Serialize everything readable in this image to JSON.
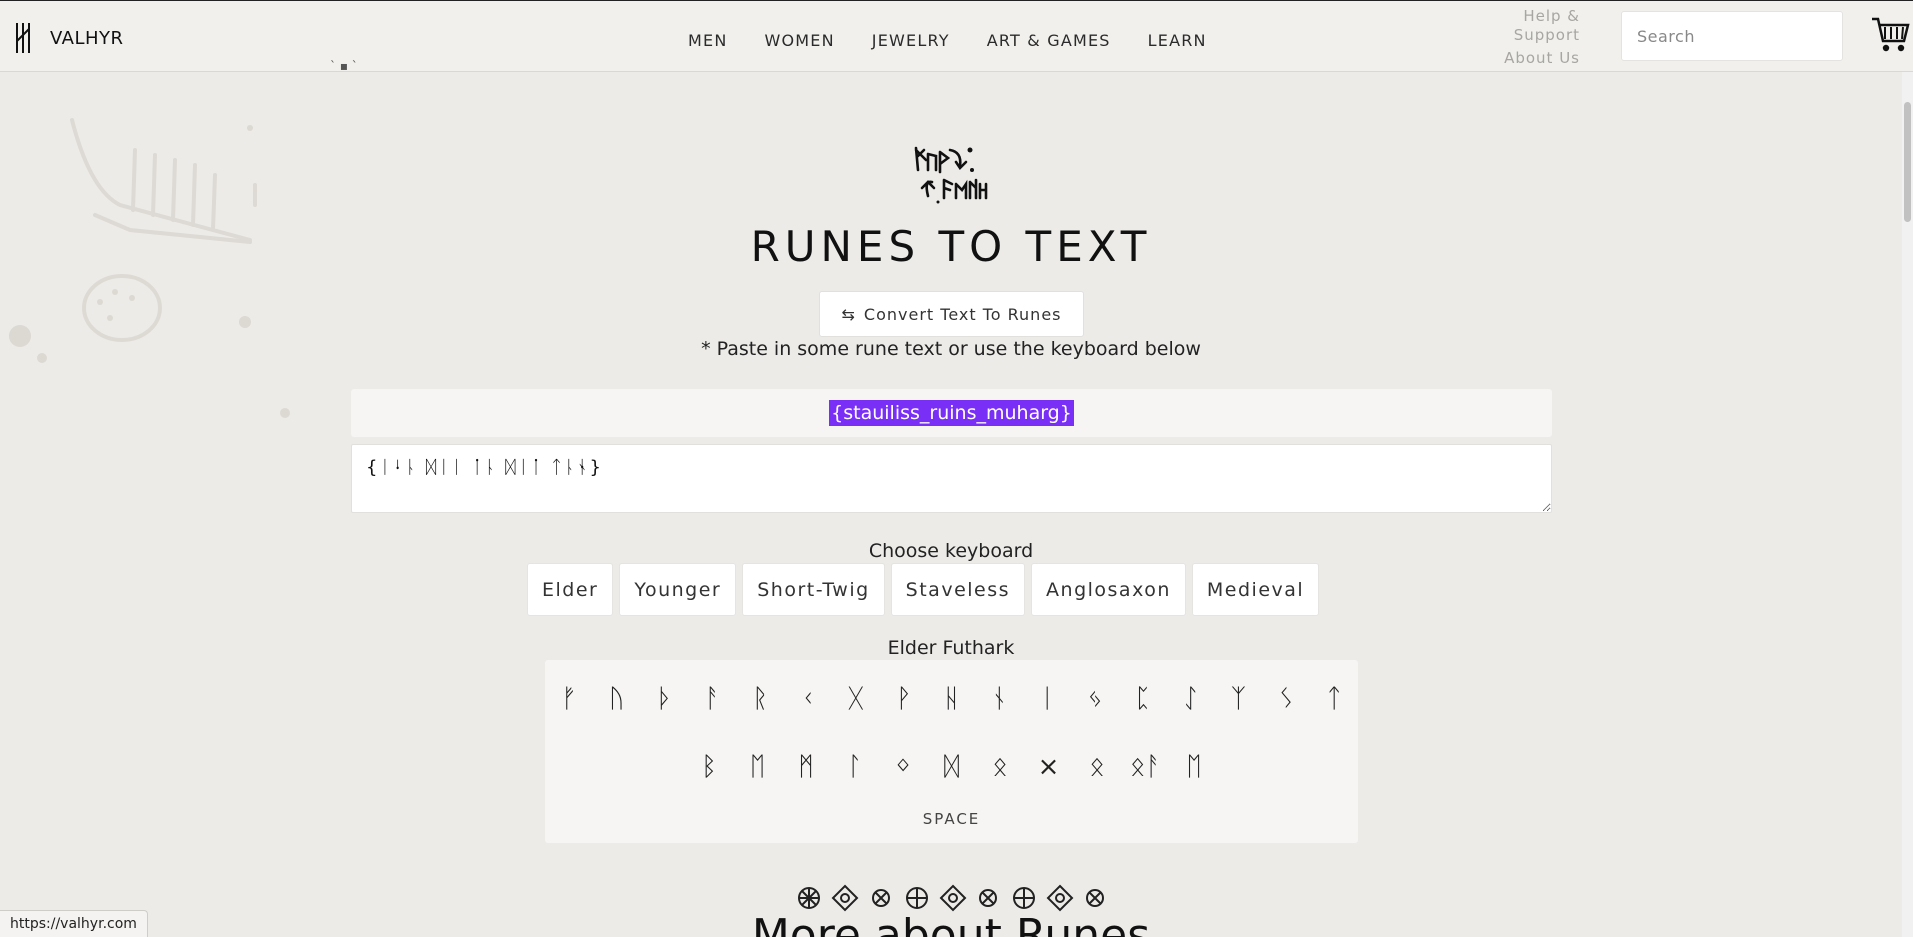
{
  "header": {
    "brand": "VALHYR",
    "nav": [
      "MEN",
      "WOMEN",
      "JEWELRY",
      "ART & GAMES",
      "LEARN"
    ],
    "help_line1": "Help &",
    "help_line2": "Support",
    "about": "About Us",
    "search_placeholder": "Search",
    "icons": [
      "valhyr-logo-icon",
      "cart-icon"
    ]
  },
  "main": {
    "title": "RUNES TO TEXT",
    "convert_button": "Convert Text To Runes",
    "convert_icon": "⇆",
    "hint": "* Paste in some rune text or use the keyboard below",
    "output_text": "{stauiliss_ruins_muharg}",
    "input_value": "{ᛁᛍᚿ ᛞᛁᛁ ᛙᚿ ᛞᛁᛙ ᛏᚿᛀ}"
  },
  "keyboard": {
    "choose_label": "Choose keyboard",
    "tabs": [
      "Elder",
      "Younger",
      "Short-Twig",
      "Staveless",
      "Anglosaxon",
      "Medieval"
    ],
    "selected_name": "Elder Futhark",
    "row1": [
      "ᚠ",
      "ᚢ",
      "ᚦ",
      "ᚨ",
      "ᚱ",
      "ᚲ",
      "ᚷ",
      "ᚹ",
      "ᚺ",
      "ᚾ",
      "ᛁ",
      "ᛃ",
      "ᛈ",
      "ᛇ",
      "ᛉ",
      "ᛊ",
      "ᛏ"
    ],
    "row2": [
      "ᛒ",
      "ᛖ",
      "ᛗ",
      "ᛚ",
      "ᛜ",
      "ᛞ",
      "ᛟ",
      "×",
      "ᛟ",
      "ᛟᚨ",
      "ᛖ"
    ],
    "space_label": "SPACE"
  },
  "footer": {
    "more_title": "More about Runes",
    "status_url": "https://valhyr.com"
  }
}
